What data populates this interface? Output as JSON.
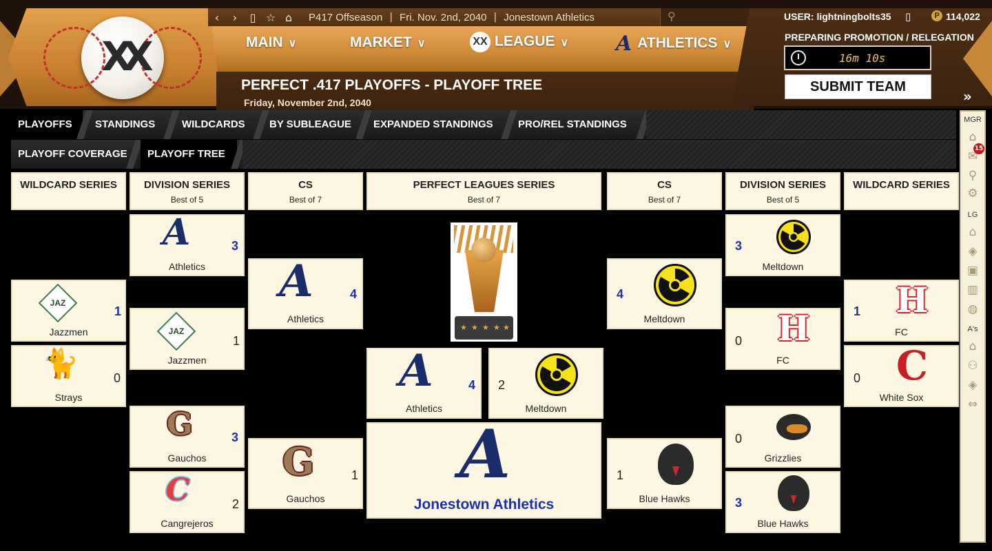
{
  "header": {
    "season": "P417 Offseason",
    "date": "Fri. Nov. 2nd, 2040",
    "team": "Jonestown Athletics",
    "separator": "|",
    "menu": [
      {
        "label": "MAIN"
      },
      {
        "label": "MARKET"
      },
      {
        "label": "LEAGUE"
      },
      {
        "label": "ATHLETICS"
      }
    ],
    "page_title": "PERFECT .417 PLAYOFFS - PLAYOFF TREE",
    "page_subtitle": "Friday, November 2nd, 2040",
    "user": "USER: lightningbolts35",
    "coins": "114,022",
    "promo_label": "PREPARING PROMOTION / RELEGATION",
    "timer": "16m 10s",
    "submit": "SUBMIT TEAM",
    "forward": "»"
  },
  "tabs_row1": [
    "PLAYOFFS",
    "STANDINGS",
    "WILDCARDS",
    "BY SUBLEAGUE",
    "EXPANDED STANDINGS",
    "PRO/REL STANDINGS"
  ],
  "tabs_row2": [
    "PLAYOFF COVERAGE",
    "PLAYOFF TREE"
  ],
  "sidebar": {
    "mgr": "MGR",
    "lg": "LG",
    "as": "A's",
    "badge": "15"
  },
  "columns": {
    "wc_left": {
      "title": "WILDCARD SERIES",
      "sub": ""
    },
    "ds_left": {
      "title": "DIVISION SERIES",
      "sub": "Best of 5"
    },
    "cs_left": {
      "title": "CS",
      "sub": "Best of 7"
    },
    "final": {
      "title": "PERFECT LEAGUES SERIES",
      "sub": "Best of 7"
    },
    "cs_right": {
      "title": "CS",
      "sub": "Best of 7"
    },
    "ds_right": {
      "title": "DIVISION SERIES",
      "sub": "Best of 5"
    },
    "wc_right": {
      "title": "WILDCARD SERIES",
      "sub": ""
    }
  },
  "bracket": {
    "wc_left": [
      {
        "name": "Jazzmen",
        "score": "1",
        "logo": "jazzmen-logo"
      },
      {
        "name": "Strays",
        "score": "0",
        "logo": "strays-cat-logo"
      }
    ],
    "ds_left": [
      {
        "name": "Athletics",
        "score": "3",
        "logo": "athletics-a-logo"
      },
      {
        "name": "Jazzmen",
        "score": "1",
        "logo": "jazzmen-logo"
      },
      {
        "name": "Gauchos",
        "score": "3",
        "logo": "gauchos-g-logo"
      },
      {
        "name": "Cangrejeros",
        "score": "2",
        "logo": "cangrejeros-c-logo"
      }
    ],
    "cs_left": [
      {
        "name": "Athletics",
        "score": "4",
        "logo": "athletics-a-logo"
      },
      {
        "name": "Gauchos",
        "score": "1",
        "logo": "gauchos-g-logo"
      }
    ],
    "final": [
      {
        "name": "Athletics",
        "score": "4",
        "logo": "athletics-a-logo"
      },
      {
        "name": "Meltdown",
        "score": "2",
        "logo": "meltdown-radiation-logo"
      }
    ],
    "champion": {
      "name": "Jonestown Athletics",
      "logo": "athletics-a-logo"
    },
    "cs_right": [
      {
        "name": "Meltdown",
        "score": "4",
        "logo": "meltdown-radiation-logo"
      },
      {
        "name": "Blue Hawks",
        "score": "1",
        "logo": "blue-hawks-logo"
      }
    ],
    "ds_right": [
      {
        "name": "Meltdown",
        "score": "3",
        "logo": "meltdown-radiation-logo"
      },
      {
        "name": "FC",
        "score": "0",
        "logo": "fc-h-logo"
      },
      {
        "name": "Grizzlies",
        "score": "0",
        "logo": "grizzlies-bear-logo"
      },
      {
        "name": "Blue Hawks",
        "score": "3",
        "logo": "blue-hawks-logo"
      }
    ],
    "wc_right": [
      {
        "name": "FC",
        "score": "1",
        "logo": "fc-h-logo"
      },
      {
        "name": "White Sox",
        "score": "0",
        "logo": "white-sox-c-logo"
      }
    ]
  },
  "logo_glyphs": {
    "athletics": "A",
    "jazzmen": "JAZ",
    "gauchos": "G",
    "cangrejeros": "C",
    "fc": "H",
    "white_sox": "C",
    "league_logo": "XX"
  },
  "colors": {
    "win_score": "#1b33a6",
    "card_bg": "#fcf6e2",
    "header_orange": "#d7913e",
    "header_brown": "#3a210e"
  }
}
